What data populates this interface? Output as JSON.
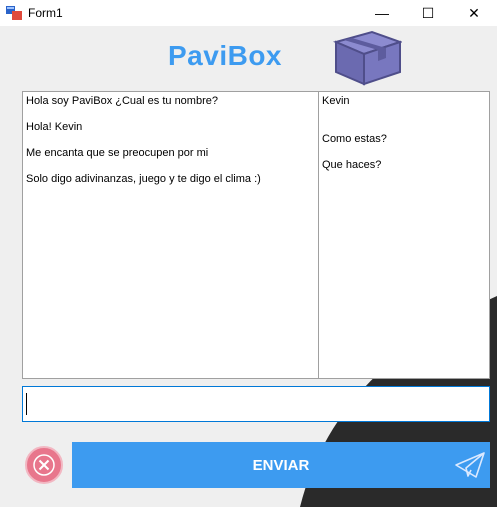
{
  "window": {
    "title": "Form1",
    "minimize_label": "—",
    "maximize_label": "☐",
    "close_label": "✕"
  },
  "brand": {
    "title": "PaviBox"
  },
  "bot_panel": {
    "lines": [
      "Hola soy PaviBox ¿Cual es tu nombre?",
      "Hola! Kevin",
      "Me encanta que se preocupen por mi",
      "Solo digo adivinanzas, juego y te digo el clima :)"
    ]
  },
  "user_panel": {
    "lines": [
      "Kevin",
      "Como estas?",
      "Que haces?"
    ]
  },
  "input": {
    "value": "",
    "placeholder": ""
  },
  "buttons": {
    "send_label": "ENVIAR"
  },
  "colors": {
    "accent": "#3d9bf0",
    "cancel": "#e8768c",
    "logo": "#6b6ab0"
  },
  "icons": [
    "app-icon",
    "box-logo-icon",
    "close-circle-icon",
    "paper-plane-icon"
  ]
}
